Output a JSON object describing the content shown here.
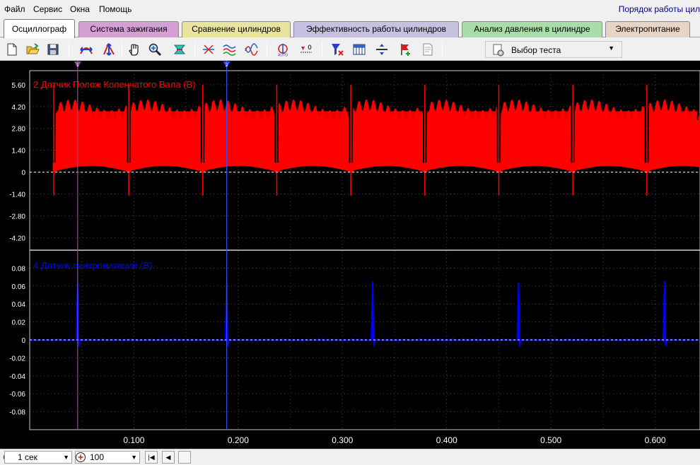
{
  "menu": [
    {
      "label": "Файл"
    },
    {
      "label": "Сервис"
    },
    {
      "label": "Окна"
    },
    {
      "label": "Помощь"
    }
  ],
  "window_title_right": "Порядок работы цил",
  "tabs": [
    {
      "label": "Осциллограф",
      "color": "#ffffff",
      "active": true
    },
    {
      "label": "Система зажигания",
      "color": "#d4a0d4"
    },
    {
      "label": "Сравнение цилиндров",
      "color": "#e8e4a0"
    },
    {
      "label": "Эффективность работы цилиндров",
      "color": "#c8c0e0"
    },
    {
      "label": "Анализ давления в цилиндре",
      "color": "#a8dca8"
    },
    {
      "label": "Электропитание",
      "color": "#e8d4c4"
    }
  ],
  "toolbar": {
    "items": [
      {
        "icon": "new-file-icon"
      },
      {
        "icon": "open-folder-icon"
      },
      {
        "icon": "save-icon"
      },
      {
        "icon": "horizontal-markers-icon"
      },
      {
        "icon": "vertical-markers-icon"
      },
      {
        "icon": "hand-pan-icon"
      },
      {
        "icon": "zoom-icon"
      },
      {
        "icon": "channel-settings-icon"
      },
      {
        "icon": "cursor-cross-icon"
      },
      {
        "icon": "waveform-overlay-icon"
      },
      {
        "icon": "phase-wave-icon"
      },
      {
        "icon": "auto-scale-icon"
      },
      {
        "icon": "zero-offset-icon"
      },
      {
        "icon": "trigger-filter-icon"
      },
      {
        "icon": "grid-table-icon"
      },
      {
        "icon": "divider-icon"
      },
      {
        "icon": "flag-add-icon"
      },
      {
        "icon": "notes-icon"
      }
    ],
    "test_select_label": "Выбор теста"
  },
  "scope": {
    "channel1": {
      "label": "2 Датчик Полож Коленчатого Вала (В)",
      "color": "#ff0000",
      "yticks": [
        "5.60",
        "4.20",
        "2.80",
        "1.40",
        "0",
        "-1.40",
        "-2.80",
        "-4.20"
      ],
      "ylim": [
        -5.0,
        6.5
      ]
    },
    "channel2": {
      "label": "4 Датчик синхронизации (В)",
      "color": "#0000ff",
      "yticks": [
        "0.08",
        "0.06",
        "0.04",
        "0.02",
        "0",
        "-0.02",
        "-0.04",
        "-0.06",
        "-0.08"
      ],
      "ylim": [
        -0.1,
        0.1
      ]
    },
    "xticks": [
      "0.100",
      "0.200",
      "0.300",
      "0.400",
      "0.500",
      "0.600"
    ],
    "xtick_values": [
      0.1,
      0.2,
      0.3,
      0.4,
      0.5,
      0.6
    ],
    "xlim": [
      0.0,
      0.643
    ],
    "marker1": {
      "label": "1",
      "x": 0.046,
      "color": "#8a4a9a"
    },
    "marker2": {
      "label": "2",
      "x": 0.189,
      "color": "#3050ff"
    },
    "ch1_gap_times": [
      0.023,
      0.095,
      0.166,
      0.237,
      0.308,
      0.379,
      0.45,
      0.521,
      0.592
    ],
    "ch2_pulse_times": [
      0.046,
      0.189,
      0.329,
      0.469,
      0.609
    ],
    "ch2_pulse_peaks": [
      0.064,
      0.067,
      0.065,
      0.064,
      0.066
    ]
  },
  "statusbar": {
    "timebase": "1 сек",
    "zoom": "100"
  }
}
